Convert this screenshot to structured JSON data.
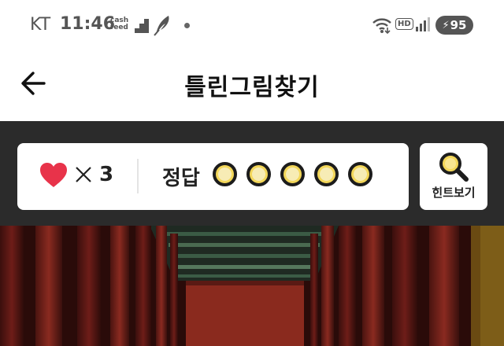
{
  "status_bar": {
    "carrier": "KT",
    "time": "11:46",
    "cashfeed_line1": "cash",
    "cashfeed_line2": "feed",
    "network_badge": "HD",
    "battery_level": "95"
  },
  "header": {
    "title": "틀린그림찾기"
  },
  "game": {
    "lives": "3",
    "answer_label": "정답",
    "answers_total": 5,
    "answers_found": 0,
    "hint_label": "힌트보기"
  },
  "colors": {
    "heart": "#e8334a",
    "answer_circle": "#f3d75a",
    "game_background": "#2b2b2b"
  }
}
